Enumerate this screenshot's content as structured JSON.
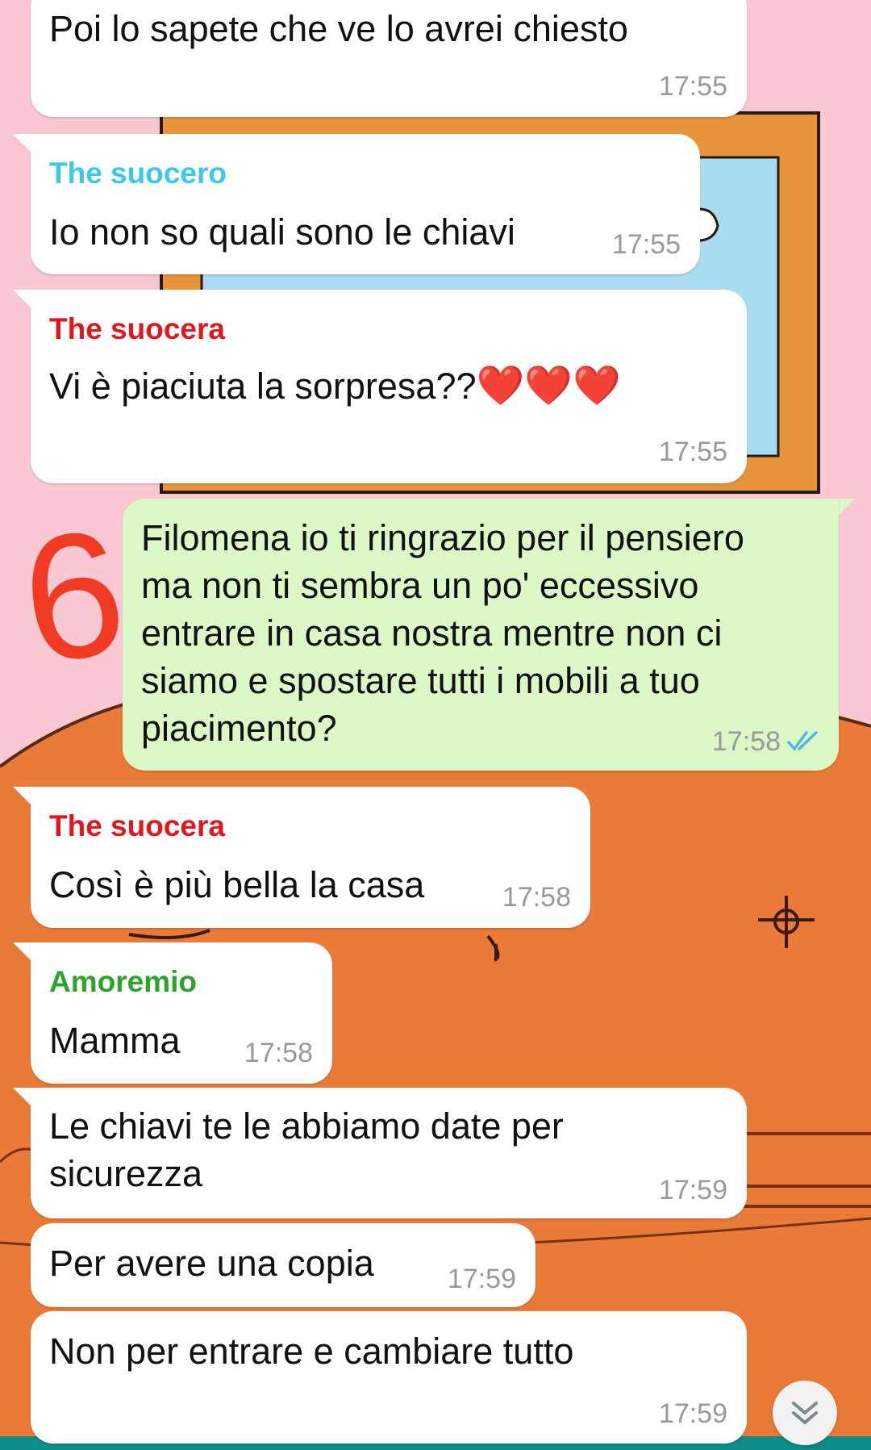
{
  "colors": {
    "incoming_bg": "#ffffff",
    "outgoing_bg": "#dcf8c6",
    "time_text": "#999999",
    "read_ticks": "#4fb6ec",
    "sender_suocero": "#3cc8e6",
    "sender_suocera": "#e0181e",
    "sender_amoremio": "#2aa52a",
    "annotation": "#f03a22"
  },
  "annotation": {
    "label": "6"
  },
  "messages": [
    {
      "text_lines": [
        "Poi lo sapete che ve lo avrei chiesto"
      ],
      "time": "17:55"
    },
    {
      "sender": "The suocero",
      "text_lines": [
        "Io non so quali sono le chiavi"
      ],
      "time": "17:55"
    },
    {
      "sender": "The suocera",
      "text_lines": [
        "Vi è piaciuta la sorpresa??"
      ],
      "emoji": "❤️❤️❤️",
      "time": "17:55"
    },
    {
      "direction": "out",
      "text_lines": [
        "Filomena io ti ringrazio per il pensiero",
        "ma non ti sembra un po' eccessivo",
        "entrare in casa nostra mentre non ci",
        "siamo e spostare tutti i mobili a tuo",
        "piacimento?"
      ],
      "time": "17:58",
      "status_icon": "double-check-read-icon"
    },
    {
      "sender": "The suocera",
      "text_lines": [
        "Così è più bella la casa"
      ],
      "time": "17:58"
    },
    {
      "sender": "Amoremio",
      "text_lines": [
        "Mamma"
      ],
      "time": "17:58"
    },
    {
      "text_lines": [
        "Le chiavi te le abbiamo date per",
        "sicurezza"
      ],
      "time": "17:59"
    },
    {
      "text_lines": [
        "Per avere una copia"
      ],
      "time": "17:59"
    },
    {
      "text_lines": [
        "Non per entrare e cambiare tutto"
      ],
      "time": "17:59"
    }
  ],
  "scroll_button": {
    "icon": "chevron-double-down-icon"
  }
}
